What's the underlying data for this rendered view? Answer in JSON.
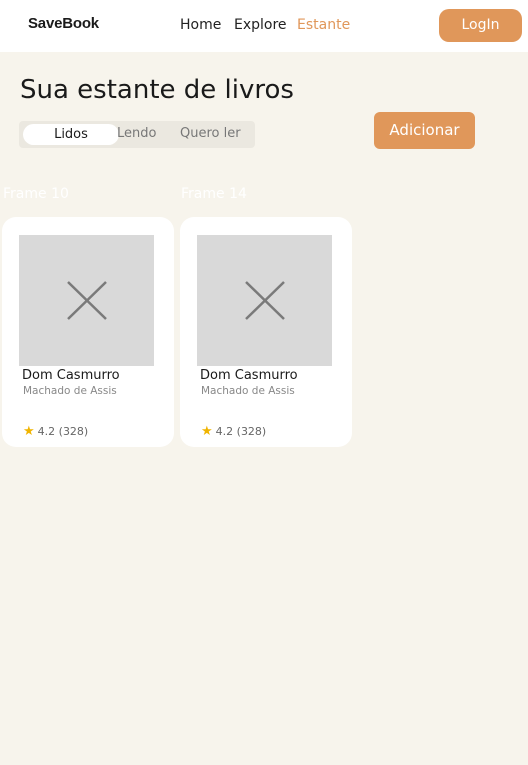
{
  "header": {
    "logo": "SaveBook",
    "nav": [
      {
        "label": "Home",
        "active": false
      },
      {
        "label": "Explore",
        "active": false
      },
      {
        "label": "Estante",
        "active": true
      }
    ],
    "login_label": "LogIn"
  },
  "main": {
    "title": "Sua estante de livros",
    "tabs": [
      {
        "label": "Lidos",
        "active": true
      },
      {
        "label": "Lendo",
        "active": false
      },
      {
        "label": "Quero ler",
        "active": false
      }
    ],
    "add_label": "Adicionar",
    "frames": [
      "Frame 10",
      "Frame 14"
    ],
    "books": [
      {
        "title": "Dom Casmurro",
        "author": "Machado de Assis",
        "rating": "4.2 (328)",
        "cover_icon": "close-icon"
      },
      {
        "title": "Dom Casmurro",
        "author": "Machado de Assis",
        "rating": "4.2 (328)",
        "cover_icon": "close-icon"
      }
    ]
  },
  "colors": {
    "accent": "#e0975a",
    "background": "#f7f4ec",
    "card": "#ffffff",
    "placeholder": "#d9d9d9"
  }
}
